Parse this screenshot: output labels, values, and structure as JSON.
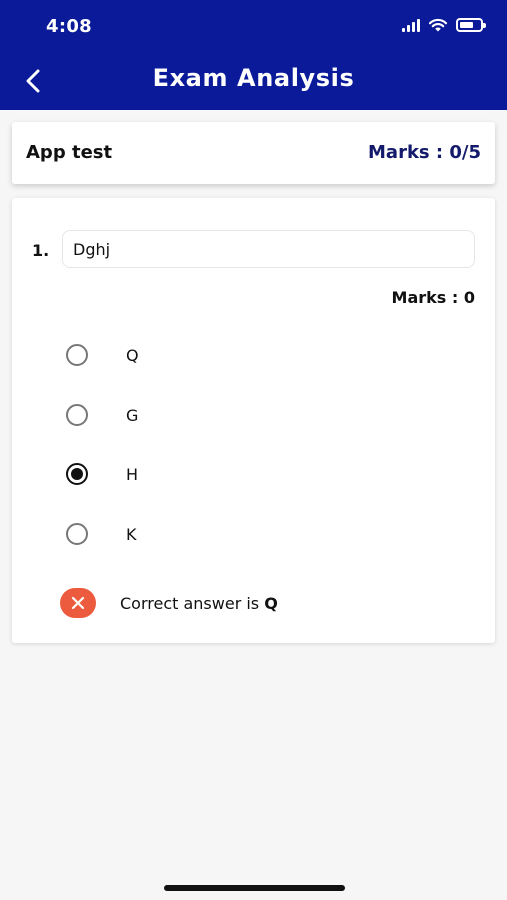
{
  "status_bar": {
    "time": "4:08"
  },
  "header": {
    "title": "Exam Analysis"
  },
  "summary": {
    "test_name": "App test",
    "marks": "Marks : 0/5"
  },
  "question": {
    "number": "1.",
    "text": "Dghj",
    "marks": "Marks : 0",
    "options": [
      {
        "label": "Q",
        "selected": false
      },
      {
        "label": "G",
        "selected": false
      },
      {
        "label": "H",
        "selected": true
      },
      {
        "label": "K",
        "selected": false
      }
    ],
    "result_prefix": "Correct answer is ",
    "correct_answer": "Q"
  },
  "colors": {
    "header_bg": "#0a1a99",
    "marks_text": "#141a6b",
    "wrong_icon": "#ec5b3e"
  }
}
